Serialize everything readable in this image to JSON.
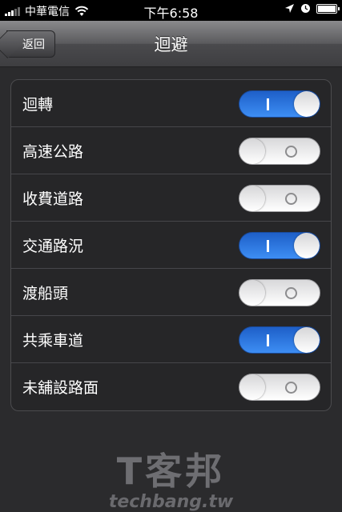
{
  "status_bar": {
    "carrier": "中華電信",
    "time": "下午6:58",
    "icons": [
      "signal-icon",
      "wifi-icon",
      "location-icon",
      "alarm-icon",
      "battery-icon"
    ]
  },
  "nav": {
    "back_label": "返回",
    "title": "迴避"
  },
  "options": [
    {
      "label": "迴轉",
      "state": "on"
    },
    {
      "label": "高速公路",
      "state": "off"
    },
    {
      "label": "收費道路",
      "state": "off"
    },
    {
      "label": "交通路況",
      "state": "on"
    },
    {
      "label": "渡船頭",
      "state": "off"
    },
    {
      "label": "共乘車道",
      "state": "on"
    },
    {
      "label": "未舖設路面",
      "state": "off"
    }
  ],
  "watermark": {
    "chinese": "T客邦",
    "english": "techbang.tw"
  },
  "colors": {
    "toggle_on": "#3d8ef4",
    "background": "#2b2b2d"
  }
}
